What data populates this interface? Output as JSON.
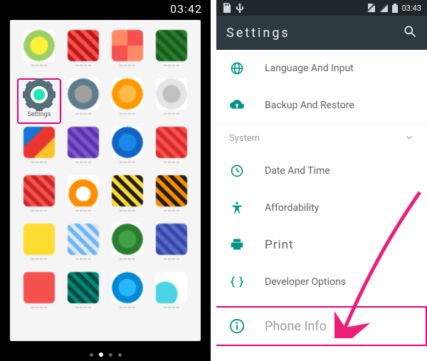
{
  "left": {
    "clock": "03:42",
    "settings_label": "Settings",
    "apps": [
      {
        "color1": "#ffeb3b",
        "color2": "#9ccc65",
        "pattern": "radial"
      },
      {
        "color1": "#ef5350",
        "color2": "#b71c1c",
        "pattern": "block"
      },
      {
        "color1": "#ef5350",
        "color2": "#ff8a65",
        "pattern": "flower"
      },
      {
        "color1": "#2e7d32",
        "color2": "#1b5e20",
        "pattern": "block"
      },
      {
        "special": "settings"
      },
      {
        "color1": "#9e9e9e",
        "color2": "#607d8b",
        "pattern": "radial"
      },
      {
        "color1": "#ffb74d",
        "color2": "#ff9800",
        "pattern": "radial"
      },
      {
        "color1": "#bdbdbd",
        "color2": "#e0e0e0",
        "pattern": "radial"
      },
      {
        "color1": "#1976d2",
        "color2": "#fbc02d",
        "pattern": "tri"
      },
      {
        "color1": "#7e57c2",
        "color2": "#5e35b1",
        "pattern": "block"
      },
      {
        "color1": "#1e88e5",
        "color2": "#1565c0",
        "pattern": "radial"
      },
      {
        "color1": "#ef5350",
        "color2": "#d32f2f",
        "pattern": "block"
      },
      {
        "color1": "#ef5350",
        "color2": "#c62828",
        "pattern": "block"
      },
      {
        "color1": "#fb8c00",
        "color2": "#ffb74d",
        "pattern": "headset"
      },
      {
        "color1": "#212121",
        "color2": "#fdd835",
        "pattern": "block"
      },
      {
        "color1": "#212121",
        "color2": "#fb8c00",
        "pattern": "block"
      },
      {
        "color1": "#fdd835",
        "color2": "#1976d2",
        "pattern": "doc"
      },
      {
        "color1": "#e0e0e0",
        "color2": "#64b5f6",
        "pattern": "block"
      },
      {
        "color1": "#43a047",
        "color2": "#2e7d32",
        "pattern": "radial"
      },
      {
        "color1": "#5c6bc0",
        "color2": "#3949ab",
        "pattern": "block"
      },
      {
        "color1": "#ef5350",
        "color2": "#004d40",
        "pattern": "cross"
      },
      {
        "color1": "#00897b",
        "color2": "#004d40",
        "pattern": "block"
      },
      {
        "color1": "#29b6f6",
        "color2": "#0288d1",
        "pattern": "radial"
      },
      {
        "color1": "#4dd0e1",
        "color2": "#26c6da",
        "pattern": "phone"
      }
    ]
  },
  "right": {
    "clock": "03:43",
    "appbar_title": "Settings",
    "items": [
      {
        "icon": "globe",
        "label": "Language And Input"
      },
      {
        "icon": "cloud",
        "label": "Backup And Restore"
      }
    ],
    "section_label": "System",
    "system_items": [
      {
        "icon": "clock",
        "label": "Date And Time"
      },
      {
        "icon": "accessibility",
        "label": "Affordability"
      },
      {
        "icon": "print",
        "label": "Print"
      },
      {
        "icon": "braces",
        "label": "Developer Options"
      }
    ],
    "phone_info_label": "Phone Info"
  }
}
